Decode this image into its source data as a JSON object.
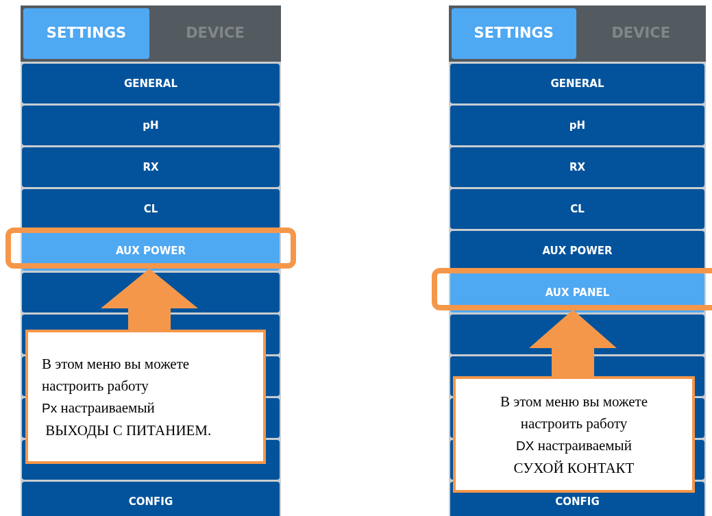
{
  "panels": [
    {
      "tabs": [
        {
          "label": "SETTINGS",
          "selected": true
        },
        {
          "label": "DEVICE",
          "selected": false
        }
      ],
      "menu": [
        {
          "label": "GENERAL",
          "selected": false
        },
        {
          "label": "pH",
          "selected": false
        },
        {
          "label": "RX",
          "selected": false
        },
        {
          "label": "CL",
          "selected": false
        },
        {
          "label": "AUX POWER",
          "selected": true
        },
        {
          "selected": false
        },
        {
          "selected": false
        },
        {
          "selected": false
        },
        {
          "selected": false
        },
        {
          "selected": false
        },
        {
          "label": "CONFIG",
          "selected": false
        }
      ],
      "callout": {
        "kind": "flush",
        "lines": [
          {
            "text": "В этом меню вы можете"
          },
          {
            "text": "настроить работу"
          },
          {
            "lead": "Px",
            "text": " настраиваемый"
          },
          {
            "text": " ВЫХОДЫ С ПИТАНИЕМ."
          }
        ]
      }
    },
    {
      "tabs": [
        {
          "label": "SETTINGS",
          "selected": true
        },
        {
          "label": "DEVICE",
          "selected": false
        }
      ],
      "menu": [
        {
          "label": "GENERAL",
          "selected": false
        },
        {
          "label": "pH",
          "selected": false
        },
        {
          "label": "RX",
          "selected": false
        },
        {
          "label": "CL",
          "selected": false
        },
        {
          "label": "AUX POWER",
          "selected": false
        },
        {
          "label": "AUX PANEL",
          "selected": true
        },
        {
          "selected": false
        },
        {
          "selected": false
        },
        {
          "selected": false
        },
        {
          "selected": false
        },
        {
          "label": "CONFIG",
          "selected": false
        }
      ],
      "callout": {
        "kind": "centered",
        "lines": [
          {
            "text": "В этом меню вы можете"
          },
          {
            "text": "настроить работу"
          },
          {
            "lead": "DX",
            "text": " настраиваемый"
          },
          {
            "text": "СУХОЙ КОНТАКТ"
          }
        ]
      }
    }
  ]
}
